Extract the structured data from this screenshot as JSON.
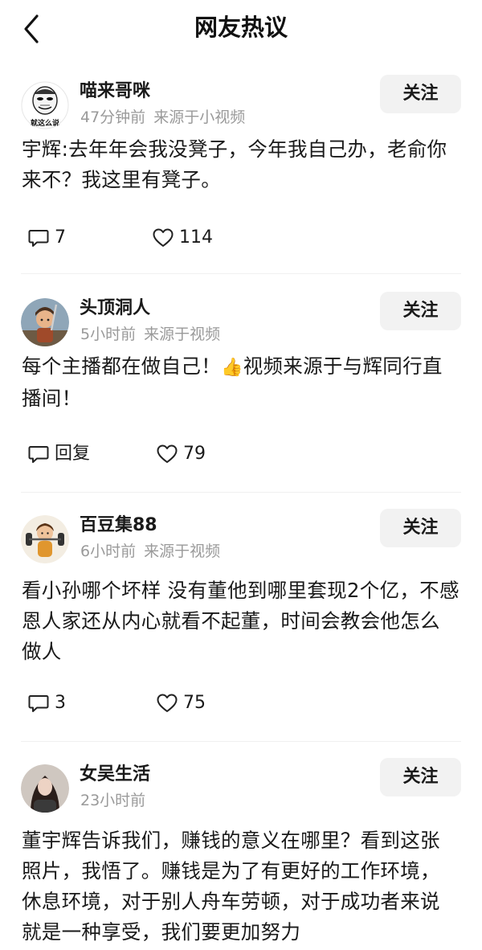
{
  "header": {
    "title": "网友热议"
  },
  "comments": [
    {
      "username": "喵来哥咪",
      "time": "47分钟前",
      "source": "来源于小视频",
      "follow_label": "关注",
      "content": "宇辉:去年年会我没凳子，今年我自己办，老俞你来不？我这里有凳子。",
      "reply_label": "7",
      "likes": "114",
      "avatar_caption": "就这么说"
    },
    {
      "username": "头顶洞人",
      "time": "5小时前",
      "source": "来源于视频",
      "follow_label": "关注",
      "content_before_emoji": "每个主播都在做自己！",
      "content_emoji": "👍",
      "content_after_emoji": "视频来源于与辉同行直播间！",
      "reply_label": "回复",
      "likes": "79"
    },
    {
      "username": "百豆集88",
      "time": "6小时前",
      "source": "来源于视频",
      "follow_label": "关注",
      "content": "看小孙哪个坏样 没有董他到哪里套现2个亿，不感恩人家还从内心就看不起董，时间会教会他怎么做人",
      "reply_label": "3",
      "likes": "75"
    },
    {
      "username": "女吴生活",
      "time": "23小时前",
      "follow_label": "关注",
      "content": "董宇辉告诉我们，赚钱的意义在哪里？看到这张照片，我悟了。赚钱是为了有更好的工作环境，休息环境，对于别人舟车劳顿，对于成功者来说就是一种享受，我们要更加努力"
    }
  ],
  "colors": {
    "meta_gray": "#9a9a9a",
    "follow_bg": "#f2f2f2",
    "divider": "#f0f0f0"
  }
}
